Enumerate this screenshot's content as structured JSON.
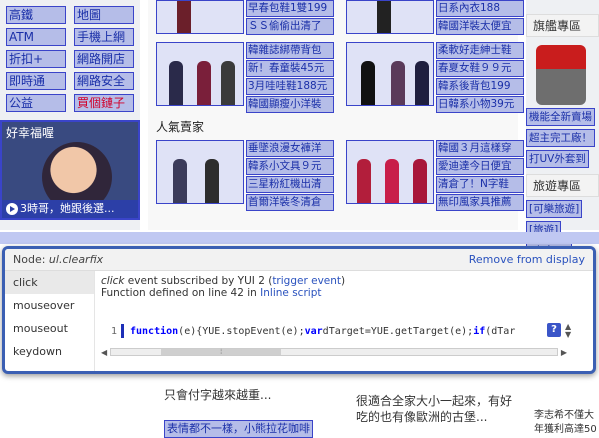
{
  "left_links": [
    [
      "高鐵",
      "地圖"
    ],
    [
      "ATM",
      "手機上網"
    ],
    [
      "折扣+",
      "網路開店"
    ],
    [
      "即時通",
      "網路安全"
    ],
    [
      "公益",
      "買個鏈子"
    ]
  ],
  "promo": {
    "title": "好幸福喔",
    "caption": "3時哥，她跟後選..."
  },
  "product_rows": [
    [
      {
        "items": [
          "早春包鞋1雙199",
          "ＳＳ偷偷出清了"
        ]
      },
      {
        "items": [
          "日系內衣188",
          "韓國洋裝太便宜"
        ]
      }
    ],
    [
      {
        "items": [
          "韓雜誌綁帶背包",
          "新！春童裝45元",
          "3月哇哇鞋188元",
          "韓國顯瘦小洋裝"
        ]
      },
      {
        "items": [
          "柔軟好走紳士鞋",
          "春夏女鞋９９元",
          "韓系後背包199",
          "日韓系小物39元"
        ]
      }
    ],
    [
      {
        "items": [
          "垂墜浪漫女褲洋",
          "韓系小文具９元",
          "三星粉紅機出清",
          "首爾洋裝冬清倉"
        ]
      },
      {
        "items": [
          "韓國３月這樣穿",
          "愛迪達今日便宜",
          "清倉了！N字鞋",
          "無印風家具推薦"
        ]
      }
    ]
  ],
  "popular_title": "人氣賣家",
  "right": {
    "head1": "旗艦專區",
    "links1": [
      "機能全新賣場",
      "超主完工廠！",
      "打UV外套到"
    ],
    "head2": "旅遊專區",
    "links2": [
      "[可樂旅遊]",
      "[旅遊]",
      "[東南亞]"
    ]
  },
  "below": {
    "line1": "只會付字越來越重...",
    "line2": "很適合全家大小一起來，有好",
    "line3": "吃的也有像歐洲的古堡...",
    "line4": "表情都不一樣，小熊拉花咖啡",
    "side1": "李志希不僅大",
    "side2": "年獲利高達50"
  },
  "inspector": {
    "node_label": "Node:",
    "node_name": "ul.clearfix",
    "remove_label": "Remove from display",
    "events": [
      "click",
      "mouseover",
      "mouseout",
      "keydown"
    ],
    "selected_event": "click",
    "subscribe_text": "click",
    "subscribe_rest": " event subscribed by YUI 2 (",
    "trigger_link": "trigger event",
    "subscribe_end": ")",
    "defined_text": "Function defined on line 42 in ",
    "inline_link": "Inline script",
    "code_line_no": "1",
    "code_kw1": "function",
    "code_mid": " (e){YUE.stopEvent(e);",
    "code_kw2": "var",
    "code_mid2": " dTarget=YUE.getTarget(e);",
    "code_kw3": "if",
    "code_end": "(dTar",
    "help_label": "?"
  }
}
